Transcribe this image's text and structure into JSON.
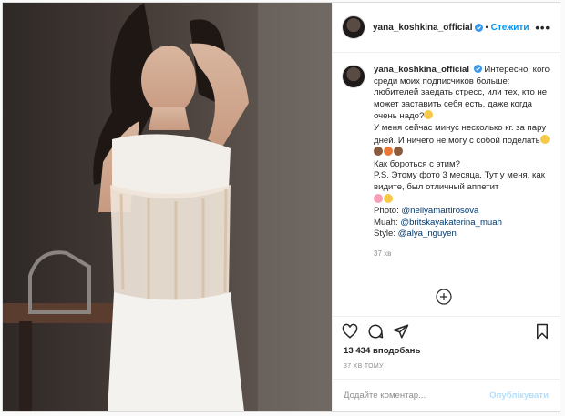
{
  "post": {
    "username": "yana_koshkina_official",
    "header_separator": "•",
    "follow_label": "Стежити",
    "more_label": "•••"
  },
  "caption": {
    "username": "yana_koshkina_official",
    "line1": "Интересно, кого среди моих подписчиков больше: любителей заедать стресс, или тех, кто не может заставить себя есть, даже когда очень надо?",
    "line2": "У меня сейчас минус несколько кг. за пару дней. И ничего не могу с собой поделать",
    "line3": "Как бороться с этим?",
    "line4": "P.S. Этому фото 3 месяца. Тут у меня, как видите, был отличный аппетит",
    "photo_label": "Photo: ",
    "photo_mention": "@nellyamartirosova",
    "muah_label": "Muah: ",
    "muah_mention": "@britskayakaterina_muah",
    "style_label": "Style: ",
    "style_mention": "@alya_nguyen",
    "time": "37 хв"
  },
  "stats": {
    "likes": "13 434 вподобань",
    "posted_ago": "37 ХВ ТОМУ"
  },
  "comment_box": {
    "placeholder": "Додайте коментар...",
    "publish_label": "Опублікувати"
  },
  "colors": {
    "accent": "#0095f6",
    "mention": "#00376b",
    "muted": "#8e8e8e",
    "publish_disabled": "#b2dffc"
  },
  "icons": [
    "verified-badge-icon",
    "heart-icon",
    "comment-icon",
    "share-icon",
    "bookmark-icon",
    "load-more-icon"
  ]
}
